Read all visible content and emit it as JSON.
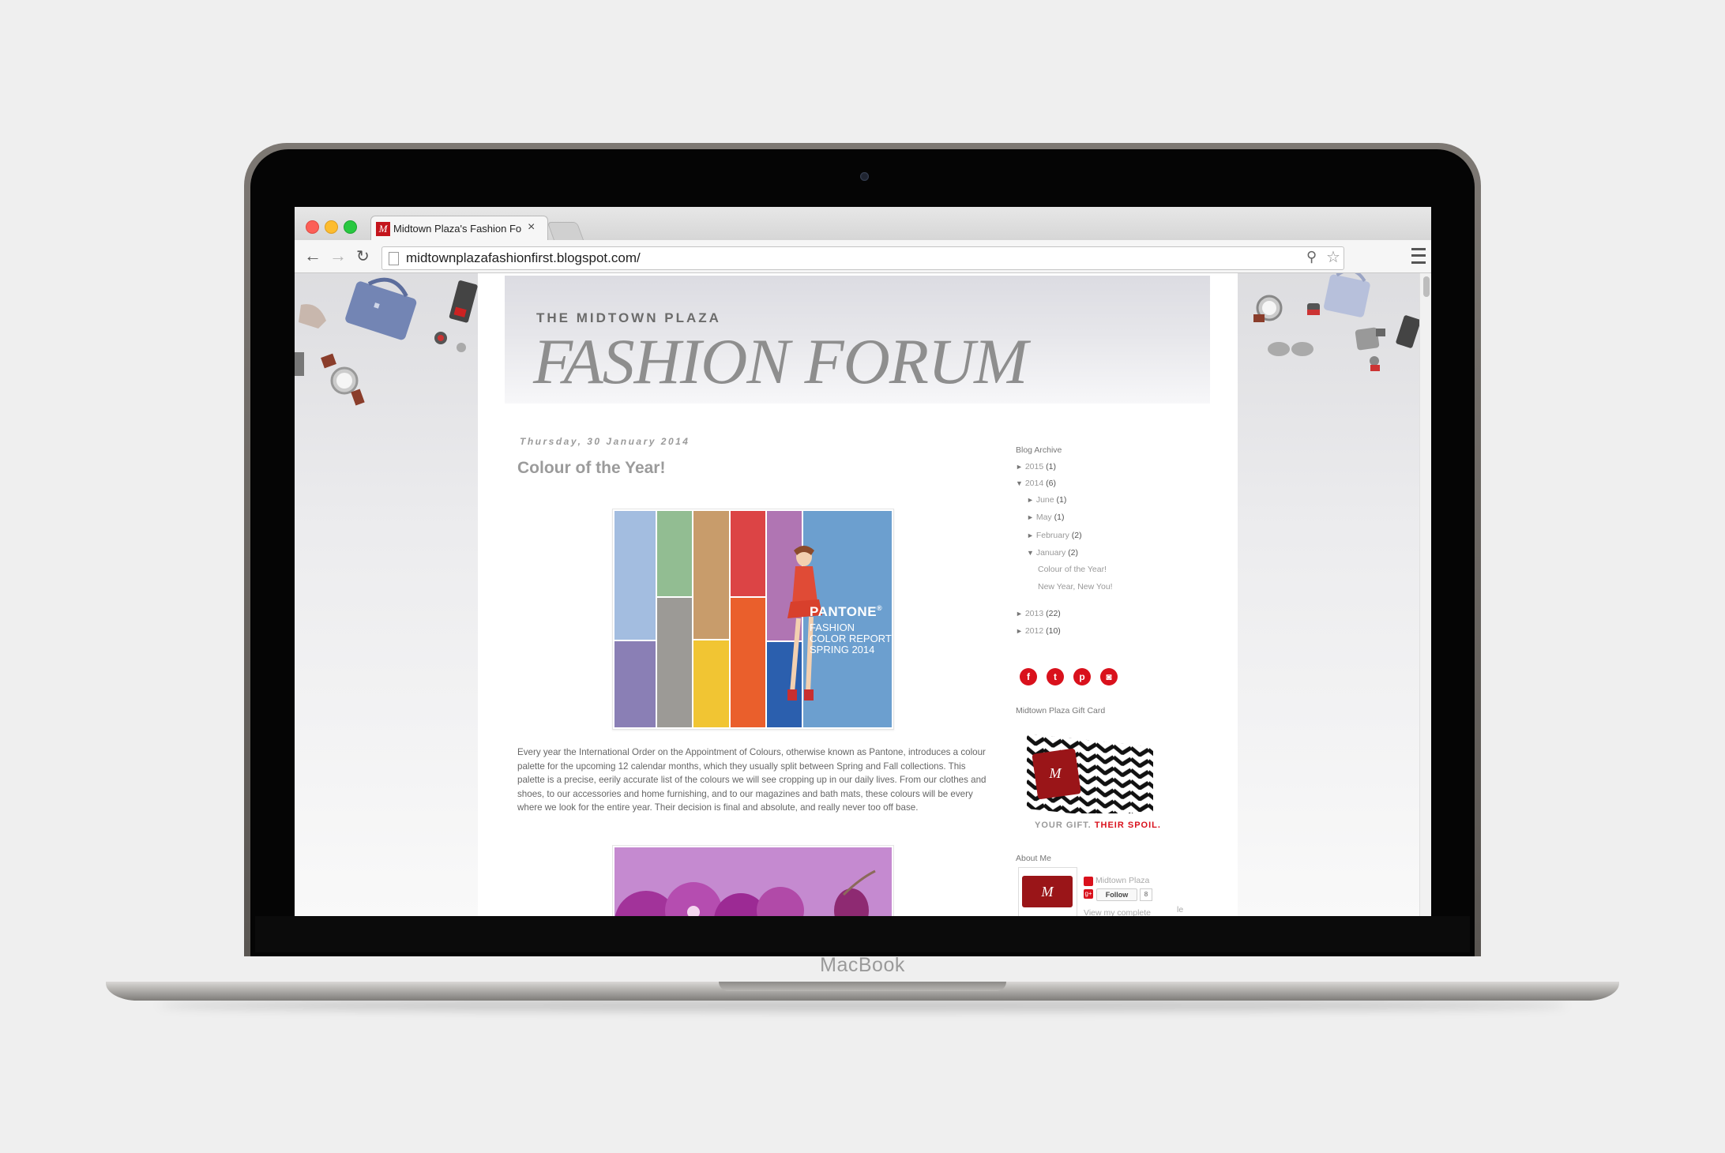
{
  "device": {
    "brand": "MacBook"
  },
  "browser": {
    "tab_title": "Midtown Plaza's Fashion Fo",
    "tab_icon_letter": "M",
    "url": "midtownplazafashionfirst.blogspot.com/"
  },
  "header": {
    "subtitle": "THE MIDTOWN PLAZA",
    "title": "FASHION FORUM"
  },
  "post": {
    "date": "Thursday, 30 January 2014",
    "title": "Colour of the Year!",
    "image_pantone": {
      "brand": "PANTONE",
      "reg": "®",
      "line1": "FASHION",
      "line2": "COLOR REPORT",
      "line3": "SPRING 2014"
    },
    "body": "Every year the International Order on the Appointment of Colours, otherwise known as Pantone, introduces a colour palette for the upcoming 12 calendar months, which they usually split between Spring and Fall collections. This palette is a precise, eerily accurate list of the colours we will see cropping up in our daily lives. From our clothes and shoes, to our accessories and home furnishing, and to our magazines and bath mats, these colours will be every where we look for the entire year. Their decision is final and absolute, and really never too off base."
  },
  "sidebar": {
    "archive_title": "Blog Archive",
    "archive": [
      {
        "arrow": "►",
        "label": "2015",
        "count": "(1)",
        "level": 0
      },
      {
        "arrow": "▼",
        "label": "2014",
        "count": "(6)",
        "level": 0
      },
      {
        "arrow": "►",
        "label": "June",
        "count": "(1)",
        "level": 1
      },
      {
        "arrow": "►",
        "label": "May",
        "count": "(1)",
        "level": 1
      },
      {
        "arrow": "►",
        "label": "February",
        "count": "(2)",
        "level": 1
      },
      {
        "arrow": "▼",
        "label": "January",
        "count": "(2)",
        "level": 1
      },
      {
        "arrow": "",
        "label": "Colour of the Year!",
        "count": "",
        "level": 2
      },
      {
        "arrow": "",
        "label": "New Year, New You!",
        "count": "",
        "level": 2
      },
      {
        "arrow": "►",
        "label": "2013",
        "count": "(22)",
        "level": 0
      },
      {
        "arrow": "►",
        "label": "2012",
        "count": "(10)",
        "level": 0
      }
    ],
    "social": [
      {
        "name": "facebook-icon",
        "glyph": "f"
      },
      {
        "name": "twitter-icon",
        "glyph": "t"
      },
      {
        "name": "pinterest-icon",
        "glyph": "p"
      },
      {
        "name": "instagram-icon",
        "glyph": "◙"
      }
    ],
    "gift_title": "Midtown Plaza Gift Card",
    "gift_tagline_a": "YOUR GIFT.",
    "gift_tagline_b": "THEIR SPOIL.",
    "about_title": "About Me",
    "profile_name": "Midtown Plaza",
    "follow_label": "Follow",
    "follow_count": "8",
    "view_profile": "View my complete",
    "stray_text": "le"
  },
  "colors": {
    "accent": "#d9111c",
    "pantone_blue": "#6c9fcf"
  }
}
